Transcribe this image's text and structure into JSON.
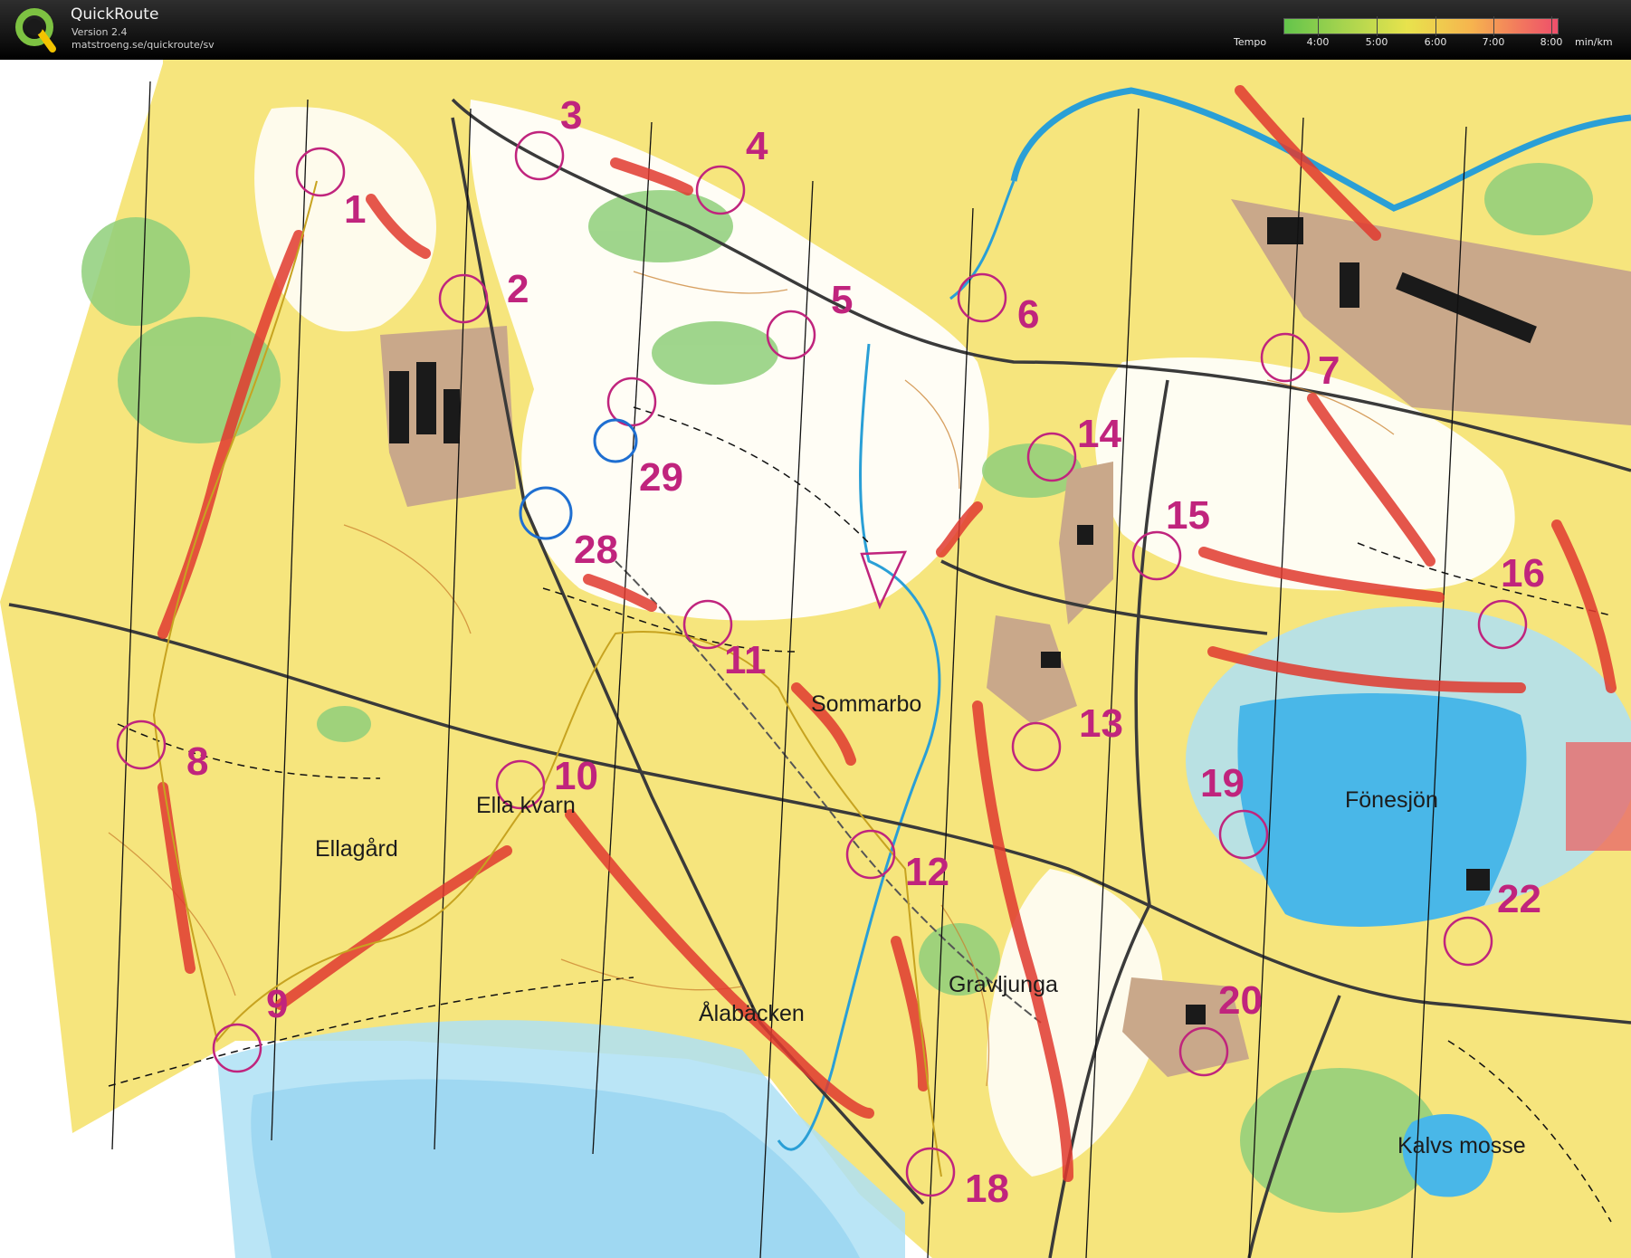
{
  "app": {
    "name": "QuickRoute",
    "version": "Version 2.4",
    "url": "matstroeng.se/quickroute/sv"
  },
  "legend": {
    "label": "Tempo",
    "ticks": [
      "4:00",
      "5:00",
      "6:00",
      "7:00",
      "8:00"
    ],
    "unit": "min/km",
    "colors": [
      "#62c44b",
      "#a7d44e",
      "#e8e34d",
      "#f6b54e",
      "#f2785e",
      "#ee4d6b"
    ]
  },
  "map": {
    "places": [
      "Sommarbo",
      "Ellagård",
      "Ella kvarn",
      "Ålabäcken",
      "Gravljunga",
      "Fönesjön",
      "Kalvs mosse"
    ],
    "controls": [
      "1",
      "2",
      "3",
      "4",
      "5",
      "6",
      "7",
      "8",
      "9",
      "10",
      "11",
      "12",
      "13",
      "14",
      "15",
      "16",
      "18",
      "19",
      "20",
      "22",
      "28",
      "29"
    ],
    "colors": {
      "course": "#c0247d",
      "open_land": "#f6e57d",
      "forest": "#ffffff",
      "green": "#8fcf7a",
      "water": "#49b7e8",
      "route": "#e03a2f",
      "contour": "#c9802f"
    }
  }
}
